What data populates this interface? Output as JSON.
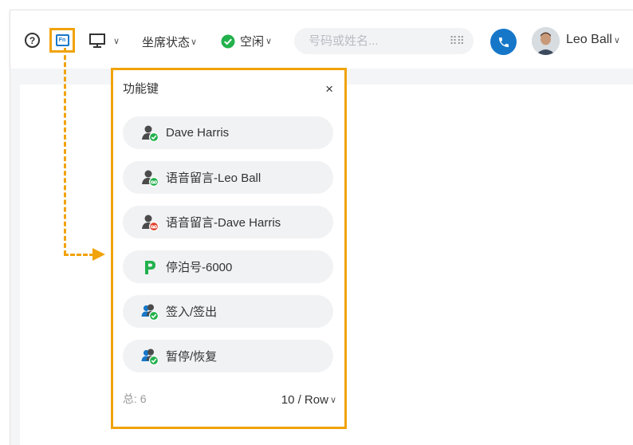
{
  "toolbar": {
    "help_symbol": "?",
    "fn_label": "Fn",
    "seat_status_label": "坐席状态",
    "presence_label": "空闲",
    "search_placeholder": "号码或姓名...",
    "user_name": "Leo Ball"
  },
  "function_keys_panel": {
    "title": "功能键",
    "close_symbol": "×",
    "items": [
      {
        "label": "Dave Harris",
        "icon": "user-available-icon"
      },
      {
        "label": "语音留言-Leo Ball",
        "icon": "user-voicemail-icon"
      },
      {
        "label": "语音留言-Dave Harris",
        "icon": "user-voicemail-red-icon"
      },
      {
        "label": "停泊号-6000",
        "icon": "parking-icon"
      },
      {
        "label": "签入/签出",
        "icon": "group-checkin-icon"
      },
      {
        "label": "暂停/恢复",
        "icon": "group-pause-icon"
      }
    ],
    "total_label": "总: 6",
    "page_size_label": "10 / Row"
  },
  "colors": {
    "highlight": "#f0a30a",
    "brand_blue": "#1677c9",
    "status_green": "#22b14c",
    "voicemail_red": "#e0432f",
    "parking_green": "#22b14c"
  }
}
